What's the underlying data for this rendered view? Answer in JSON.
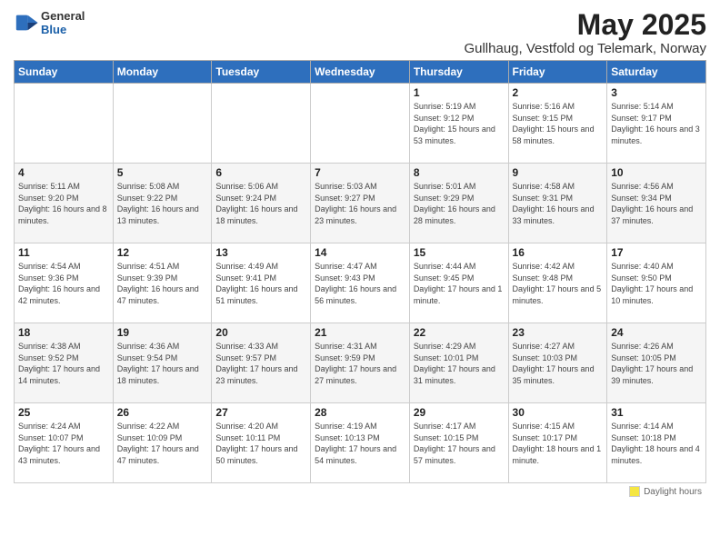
{
  "header": {
    "logo_general": "General",
    "logo_blue": "Blue",
    "main_title": "May 2025",
    "subtitle": "Gullhaug, Vestfold og Telemark, Norway"
  },
  "days_of_week": [
    "Sunday",
    "Monday",
    "Tuesday",
    "Wednesday",
    "Thursday",
    "Friday",
    "Saturday"
  ],
  "footer_legend": "Daylight hours",
  "weeks": [
    [
      {
        "day": "",
        "sunrise": "",
        "sunset": "",
        "daylight": ""
      },
      {
        "day": "",
        "sunrise": "",
        "sunset": "",
        "daylight": ""
      },
      {
        "day": "",
        "sunrise": "",
        "sunset": "",
        "daylight": ""
      },
      {
        "day": "",
        "sunrise": "",
        "sunset": "",
        "daylight": ""
      },
      {
        "day": "1",
        "sunrise": "Sunrise: 5:19 AM",
        "sunset": "Sunset: 9:12 PM",
        "daylight": "Daylight: 15 hours and 53 minutes."
      },
      {
        "day": "2",
        "sunrise": "Sunrise: 5:16 AM",
        "sunset": "Sunset: 9:15 PM",
        "daylight": "Daylight: 15 hours and 58 minutes."
      },
      {
        "day": "3",
        "sunrise": "Sunrise: 5:14 AM",
        "sunset": "Sunset: 9:17 PM",
        "daylight": "Daylight: 16 hours and 3 minutes."
      }
    ],
    [
      {
        "day": "4",
        "sunrise": "Sunrise: 5:11 AM",
        "sunset": "Sunset: 9:20 PM",
        "daylight": "Daylight: 16 hours and 8 minutes."
      },
      {
        "day": "5",
        "sunrise": "Sunrise: 5:08 AM",
        "sunset": "Sunset: 9:22 PM",
        "daylight": "Daylight: 16 hours and 13 minutes."
      },
      {
        "day": "6",
        "sunrise": "Sunrise: 5:06 AM",
        "sunset": "Sunset: 9:24 PM",
        "daylight": "Daylight: 16 hours and 18 minutes."
      },
      {
        "day": "7",
        "sunrise": "Sunrise: 5:03 AM",
        "sunset": "Sunset: 9:27 PM",
        "daylight": "Daylight: 16 hours and 23 minutes."
      },
      {
        "day": "8",
        "sunrise": "Sunrise: 5:01 AM",
        "sunset": "Sunset: 9:29 PM",
        "daylight": "Daylight: 16 hours and 28 minutes."
      },
      {
        "day": "9",
        "sunrise": "Sunrise: 4:58 AM",
        "sunset": "Sunset: 9:31 PM",
        "daylight": "Daylight: 16 hours and 33 minutes."
      },
      {
        "day": "10",
        "sunrise": "Sunrise: 4:56 AM",
        "sunset": "Sunset: 9:34 PM",
        "daylight": "Daylight: 16 hours and 37 minutes."
      }
    ],
    [
      {
        "day": "11",
        "sunrise": "Sunrise: 4:54 AM",
        "sunset": "Sunset: 9:36 PM",
        "daylight": "Daylight: 16 hours and 42 minutes."
      },
      {
        "day": "12",
        "sunrise": "Sunrise: 4:51 AM",
        "sunset": "Sunset: 9:39 PM",
        "daylight": "Daylight: 16 hours and 47 minutes."
      },
      {
        "day": "13",
        "sunrise": "Sunrise: 4:49 AM",
        "sunset": "Sunset: 9:41 PM",
        "daylight": "Daylight: 16 hours and 51 minutes."
      },
      {
        "day": "14",
        "sunrise": "Sunrise: 4:47 AM",
        "sunset": "Sunset: 9:43 PM",
        "daylight": "Daylight: 16 hours and 56 minutes."
      },
      {
        "day": "15",
        "sunrise": "Sunrise: 4:44 AM",
        "sunset": "Sunset: 9:45 PM",
        "daylight": "Daylight: 17 hours and 1 minute."
      },
      {
        "day": "16",
        "sunrise": "Sunrise: 4:42 AM",
        "sunset": "Sunset: 9:48 PM",
        "daylight": "Daylight: 17 hours and 5 minutes."
      },
      {
        "day": "17",
        "sunrise": "Sunrise: 4:40 AM",
        "sunset": "Sunset: 9:50 PM",
        "daylight": "Daylight: 17 hours and 10 minutes."
      }
    ],
    [
      {
        "day": "18",
        "sunrise": "Sunrise: 4:38 AM",
        "sunset": "Sunset: 9:52 PM",
        "daylight": "Daylight: 17 hours and 14 minutes."
      },
      {
        "day": "19",
        "sunrise": "Sunrise: 4:36 AM",
        "sunset": "Sunset: 9:54 PM",
        "daylight": "Daylight: 17 hours and 18 minutes."
      },
      {
        "day": "20",
        "sunrise": "Sunrise: 4:33 AM",
        "sunset": "Sunset: 9:57 PM",
        "daylight": "Daylight: 17 hours and 23 minutes."
      },
      {
        "day": "21",
        "sunrise": "Sunrise: 4:31 AM",
        "sunset": "Sunset: 9:59 PM",
        "daylight": "Daylight: 17 hours and 27 minutes."
      },
      {
        "day": "22",
        "sunrise": "Sunrise: 4:29 AM",
        "sunset": "Sunset: 10:01 PM",
        "daylight": "Daylight: 17 hours and 31 minutes."
      },
      {
        "day": "23",
        "sunrise": "Sunrise: 4:27 AM",
        "sunset": "Sunset: 10:03 PM",
        "daylight": "Daylight: 17 hours and 35 minutes."
      },
      {
        "day": "24",
        "sunrise": "Sunrise: 4:26 AM",
        "sunset": "Sunset: 10:05 PM",
        "daylight": "Daylight: 17 hours and 39 minutes."
      }
    ],
    [
      {
        "day": "25",
        "sunrise": "Sunrise: 4:24 AM",
        "sunset": "Sunset: 10:07 PM",
        "daylight": "Daylight: 17 hours and 43 minutes."
      },
      {
        "day": "26",
        "sunrise": "Sunrise: 4:22 AM",
        "sunset": "Sunset: 10:09 PM",
        "daylight": "Daylight: 17 hours and 47 minutes."
      },
      {
        "day": "27",
        "sunrise": "Sunrise: 4:20 AM",
        "sunset": "Sunset: 10:11 PM",
        "daylight": "Daylight: 17 hours and 50 minutes."
      },
      {
        "day": "28",
        "sunrise": "Sunrise: 4:19 AM",
        "sunset": "Sunset: 10:13 PM",
        "daylight": "Daylight: 17 hours and 54 minutes."
      },
      {
        "day": "29",
        "sunrise": "Sunrise: 4:17 AM",
        "sunset": "Sunset: 10:15 PM",
        "daylight": "Daylight: 17 hours and 57 minutes."
      },
      {
        "day": "30",
        "sunrise": "Sunrise: 4:15 AM",
        "sunset": "Sunset: 10:17 PM",
        "daylight": "Daylight: 18 hours and 1 minute."
      },
      {
        "day": "31",
        "sunrise": "Sunrise: 4:14 AM",
        "sunset": "Sunset: 10:18 PM",
        "daylight": "Daylight: 18 hours and 4 minutes."
      }
    ]
  ]
}
